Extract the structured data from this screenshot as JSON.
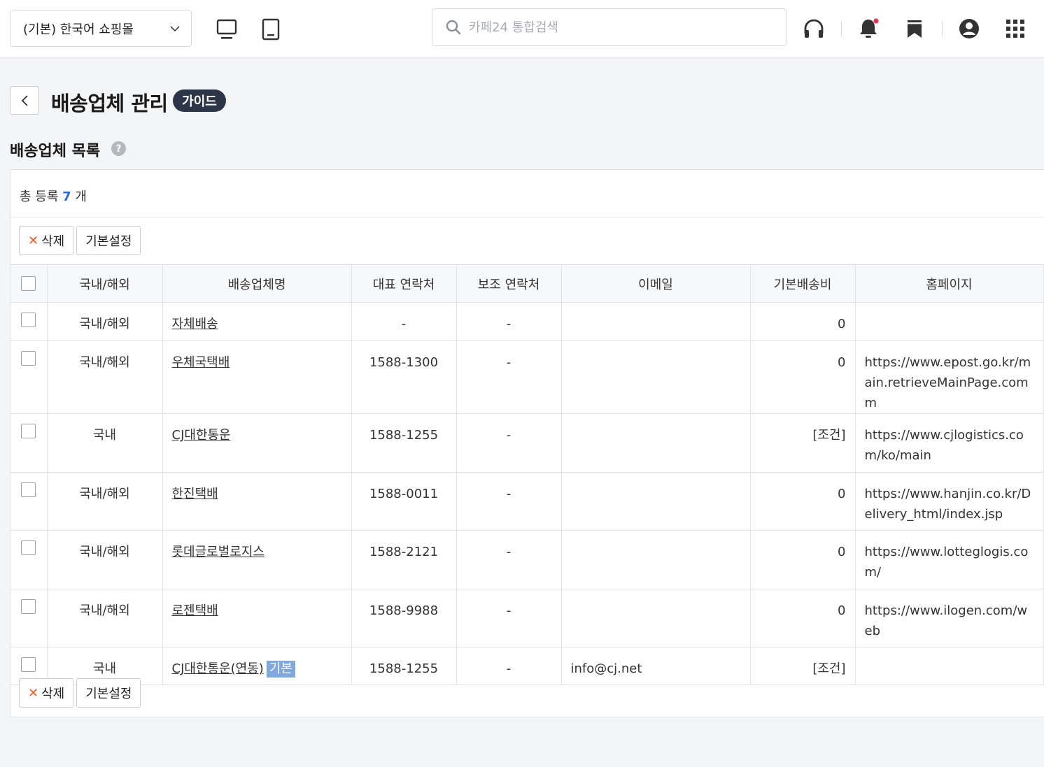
{
  "header": {
    "mall_select": "(기본) 한국어 쇼핑몰",
    "search_placeholder": "카페24 통합검색"
  },
  "title": {
    "page_title": "배송업체 관리",
    "guide_badge": "가이드",
    "section_title": "배송업체 목록",
    "help_glyph": "?"
  },
  "summary": {
    "prefix": "총 등록",
    "count": "7",
    "suffix": "개"
  },
  "actions": {
    "delete_label": "삭제",
    "set_default_label": "기본설정"
  },
  "table": {
    "columns": [
      "국내/해외",
      "배송업체명",
      "대표 연락처",
      "보조 연락처",
      "이메일",
      "기본배송비",
      "홈페이지"
    ],
    "rows": [
      {
        "region": "국내/해외",
        "name": "자체배송",
        "tag": "",
        "phone": "-",
        "sub_phone": "-",
        "email": "",
        "fee": "0",
        "homepage": ""
      },
      {
        "region": "국내/해외",
        "name": "우체국택배",
        "tag": "",
        "phone": "1588-1300",
        "sub_phone": "-",
        "email": "",
        "fee": "0",
        "homepage": "https://www.epost.go.kr/main.retrieveMainPage.comm"
      },
      {
        "region": "국내",
        "name": "CJ대한통운",
        "tag": "",
        "phone": "1588-1255",
        "sub_phone": "-",
        "email": "",
        "fee": "[조건]",
        "homepage": "https://www.cjlogistics.com/ko/main"
      },
      {
        "region": "국내/해외",
        "name": "한진택배",
        "tag": "",
        "phone": "1588-0011",
        "sub_phone": "-",
        "email": "",
        "fee": "0",
        "homepage": "https://www.hanjin.co.kr/Delivery_html/index.jsp"
      },
      {
        "region": "국내/해외",
        "name": "롯데글로벌로지스",
        "tag": "",
        "phone": "1588-2121",
        "sub_phone": "-",
        "email": "",
        "fee": "0",
        "homepage": "https://www.lotteglogis.com/"
      },
      {
        "region": "국내/해외",
        "name": "로젠택배",
        "tag": "",
        "phone": "1588-9988",
        "sub_phone": "-",
        "email": "",
        "fee": "0",
        "homepage": "https://www.ilogen.com/web"
      },
      {
        "region": "국내",
        "name": "CJ대한통운(연동)",
        "tag": "기본",
        "phone": "1588-1255",
        "sub_phone": "-",
        "email": "info@cj.net",
        "fee": "[조건]",
        "homepage": ""
      }
    ]
  },
  "icons": {
    "search": "search-icon",
    "headset": "headset-icon",
    "bell": "bell-icon",
    "bookmark": "bookmark-icon",
    "account": "account-icon",
    "apps": "apps-grid-icon",
    "desktop": "desktop-icon",
    "tablet": "tablet-icon"
  },
  "colors": {
    "accent": "#2f6bd8",
    "badge_dark": "#2d3648",
    "delete_x": "#ee5a28",
    "notification_dot": "#e8344e",
    "default_tag": "#7fa7e0"
  }
}
